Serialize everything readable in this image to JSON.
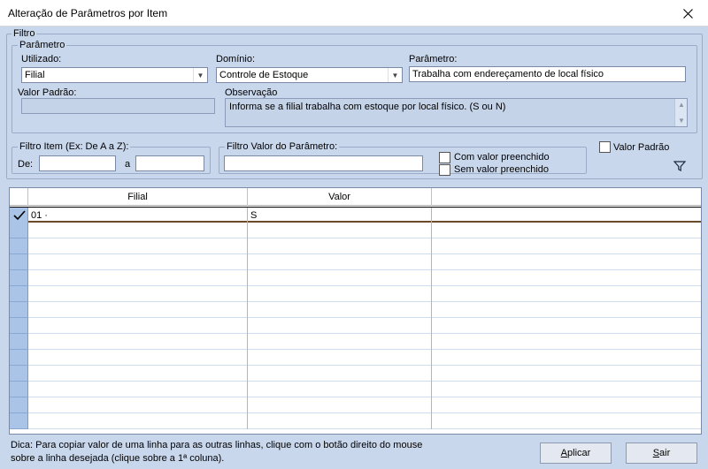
{
  "window": {
    "title": "Alteração de Parâmetros por Item"
  },
  "filtro": {
    "legend": "Filtro",
    "parametro_group": {
      "legend": "Parâmetro",
      "utilizado": {
        "label": "Utilizado:",
        "value": "Filial"
      },
      "dominio": {
        "label": "Domínio:",
        "value": "Controle de Estoque"
      },
      "parametro": {
        "label": "Parâmetro:",
        "value": "Trabalha com endereçamento de local físico"
      },
      "valor_padrao": {
        "label": "Valor Padrão:",
        "value": ""
      },
      "observacao": {
        "label": "Observação",
        "value": "Informa se a filial trabalha com estoque por local físico. (S ou N)"
      }
    },
    "filtro_item": {
      "legend": "Filtro Item (Ex: De A a Z):",
      "de_label": "De:",
      "a_label": "a",
      "de_value": "",
      "a_value": ""
    },
    "filtro_valor": {
      "legend": "Filtro Valor do Parâmetro:",
      "value": "",
      "com_valor": "Com valor preenchido",
      "sem_valor": "Sem valor preenchido"
    },
    "valor_padrao_check": "Valor Padrão"
  },
  "grid": {
    "columns": [
      "Filial",
      "Valor"
    ],
    "rows": [
      {
        "filial": "01 ·",
        "valor": "S"
      }
    ]
  },
  "footer": {
    "hint_line1": "Dica: Para copiar valor de uma linha para as outras linhas, clique com o botão direito do mouse",
    "hint_line2": "sobre a linha desejada (clique sobre a 1ª coluna).",
    "aplicar_first": "A",
    "aplicar_rest": "plicar",
    "sair_first": "S",
    "sair_rest": "air"
  }
}
